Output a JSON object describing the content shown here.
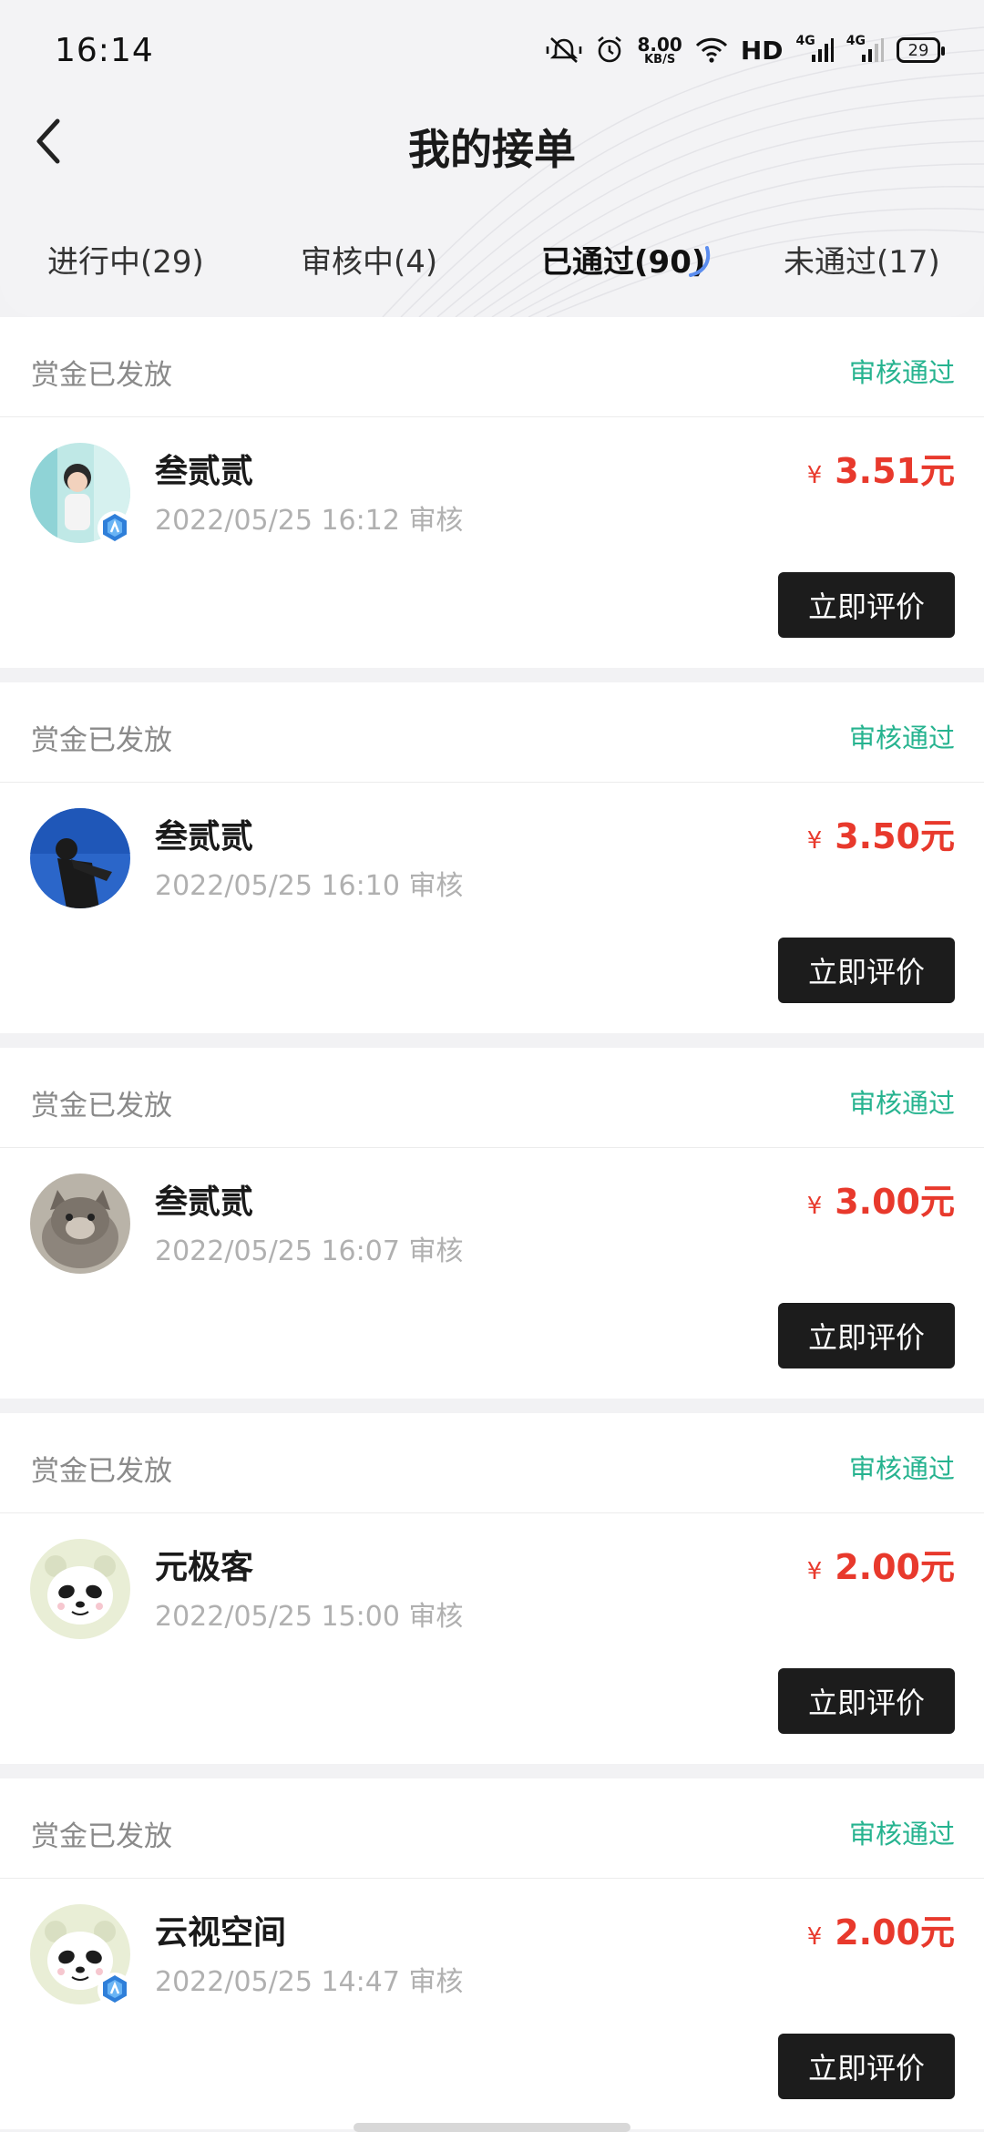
{
  "status_bar": {
    "time": "16:14",
    "speed_value": "8.00",
    "speed_unit": "KB/S",
    "hd": "HD",
    "net1": "4G",
    "net2": "4G",
    "battery": "29"
  },
  "header": {
    "title": "我的接单"
  },
  "tabs": [
    {
      "label": "进行中(29)"
    },
    {
      "label": "审核中(4)"
    },
    {
      "label": "已通过(90)"
    },
    {
      "label": "未通过(17)"
    }
  ],
  "active_tab": 2,
  "orders": [
    {
      "status": "赏金已发放",
      "review": "审核通过",
      "name": "叁贰贰",
      "time": "2022/05/25 16:12 审核",
      "currency": "¥",
      "amount": "3.51元",
      "button": "立即评价",
      "avatar": "avatar-girl",
      "verified": true
    },
    {
      "status": "赏金已发放",
      "review": "审核通过",
      "name": "叁贰贰",
      "time": "2022/05/25 16:10 审核",
      "currency": "¥",
      "amount": "3.50元",
      "button": "立即评价",
      "avatar": "avatar-sky",
      "verified": false
    },
    {
      "status": "赏金已发放",
      "review": "审核通过",
      "name": "叁贰贰",
      "time": "2022/05/25 16:07 审核",
      "currency": "¥",
      "amount": "3.00元",
      "button": "立即评价",
      "avatar": "avatar-cat",
      "verified": false
    },
    {
      "status": "赏金已发放",
      "review": "审核通过",
      "name": "元极客",
      "time": "2022/05/25 15:00 审核",
      "currency": "¥",
      "amount": "2.00元",
      "button": "立即评价",
      "avatar": "avatar-panda",
      "verified": false
    },
    {
      "status": "赏金已发放",
      "review": "审核通过",
      "name": "云视空间",
      "time": "2022/05/25 14:47 审核",
      "currency": "¥",
      "amount": "2.00元",
      "button": "立即评价",
      "avatar": "avatar-panda",
      "verified": true
    }
  ],
  "colors": {
    "accent_green": "#26b38f",
    "price_red": "#e8392c",
    "button_dark": "#1c1c1c"
  }
}
